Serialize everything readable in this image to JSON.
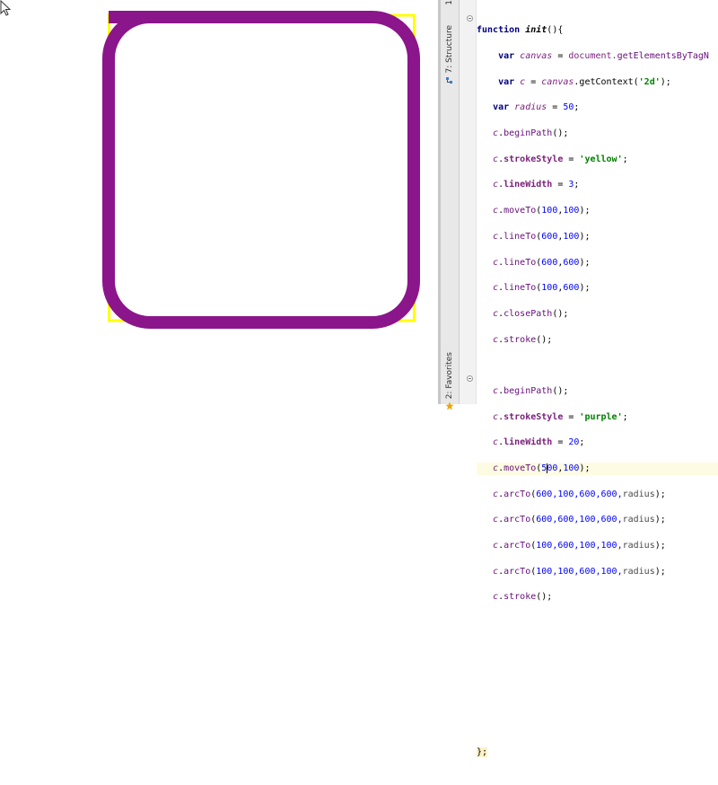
{
  "toolstrip": {
    "top_tab": "1",
    "structure_tab": "7: Structure",
    "favorites_tab": "2: Favorites"
  },
  "colors": {
    "purple": "#8b158b",
    "yellow": "#ffff00",
    "current_line": "#fdfce2"
  },
  "code": {
    "l1_kw": "function",
    "l1_name": "init",
    "l1_rest": "(){",
    "l2_kw": "var",
    "l2_var": "canvas",
    "l2_eq": " = ",
    "l2_obj": "document",
    "l2_method": ".getElementsByTagN",
    "l3_kw": "var",
    "l3_var": "c",
    "l3_eq": " = ",
    "l3_obj": "canvas",
    "l3_method": ".getContext(",
    "l3_str": "'2d'",
    "l3_end": ");",
    "l4_kw": "var",
    "l4_var": "radius",
    "l4_eq": " = ",
    "l4_num": "50",
    "l4_end": ";",
    "l5": "beginPath",
    "l6_prop": "strokeStyle",
    "l6_str": "'yellow'",
    "l7_prop": "lineWidth",
    "l7_num": "3",
    "l8_fn": "moveTo",
    "l8_args": [
      "100",
      "100"
    ],
    "l9_fn": "lineTo",
    "l9_args": [
      "600",
      "100"
    ],
    "l10_fn": "lineTo",
    "l10_args": [
      "600",
      "600"
    ],
    "l11_fn": "lineTo",
    "l11_args": [
      "100",
      "600"
    ],
    "l12": "closePath",
    "l13": "stroke",
    "l15": "beginPath",
    "l16_prop": "strokeStyle",
    "l16_str": "'purple'",
    "l17_prop": "lineWidth",
    "l17_num": "20",
    "l18_fn": "moveTo",
    "l18_a": "5",
    "l18_b": "00",
    "l18_c": "100",
    "l19_fn": "arcTo",
    "l19_args": "600,100,600,600,",
    "l20_fn": "arcTo",
    "l20_args": "600,600,100,600,",
    "l21_fn": "arcTo",
    "l21_args": "100,600,100,100,",
    "l22_fn": "arcTo",
    "l22_args": "100,100,600,100,",
    "radius_id": "radius",
    "l23": "stroke",
    "l_close": "};"
  }
}
